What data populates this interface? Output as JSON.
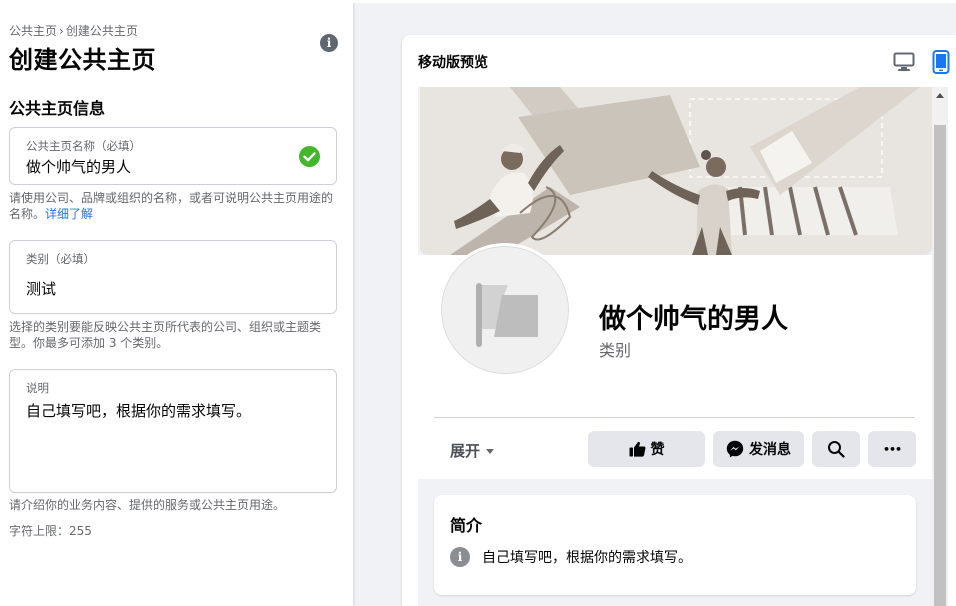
{
  "breadcrumb": {
    "parent": "公共主页",
    "separator": "›",
    "current": "创建公共主页"
  },
  "page_title": "创建公共主页",
  "info_glyph": "i",
  "section_title": "公共主页信息",
  "name_field": {
    "label": "公共主页名称（必填）",
    "value": "做个帅气的男人",
    "valid": true
  },
  "name_help": {
    "text": "请使用公司、品牌或组织的名称，或者可说明公共主页用途的名称。",
    "link": "详细了解"
  },
  "category_field": {
    "label": "类别（必填）",
    "value": "测试"
  },
  "category_help": "选择的类别要能反映公共主页所代表的公司、组织或主题类型。你最多可添加 3 个类别。",
  "desc_field": {
    "label": "说明",
    "value": "自己填写吧，根据你的需求填写。"
  },
  "desc_help": "请介绍你的业务内容、提供的服务或公共主页用途。",
  "char_limit": "字符上限：255",
  "preview": {
    "title": "移动版预览",
    "mode_icons": [
      "desktop-icon",
      "mobile-icon"
    ],
    "active_mode": "mobile",
    "page_name": "做个帅气的男人",
    "page_category": "类别",
    "expand_label": "展开",
    "like_label": "赞",
    "message_label": "发消息",
    "more_glyph": "•••",
    "about_title": "简介",
    "about_text": "自己填写吧，根据你的需求填写。"
  },
  "colors": {
    "accent": "#1877f2",
    "success": "#42b72a",
    "button_bg": "#e4e6eb",
    "page_bg": "#f0f2f5"
  }
}
